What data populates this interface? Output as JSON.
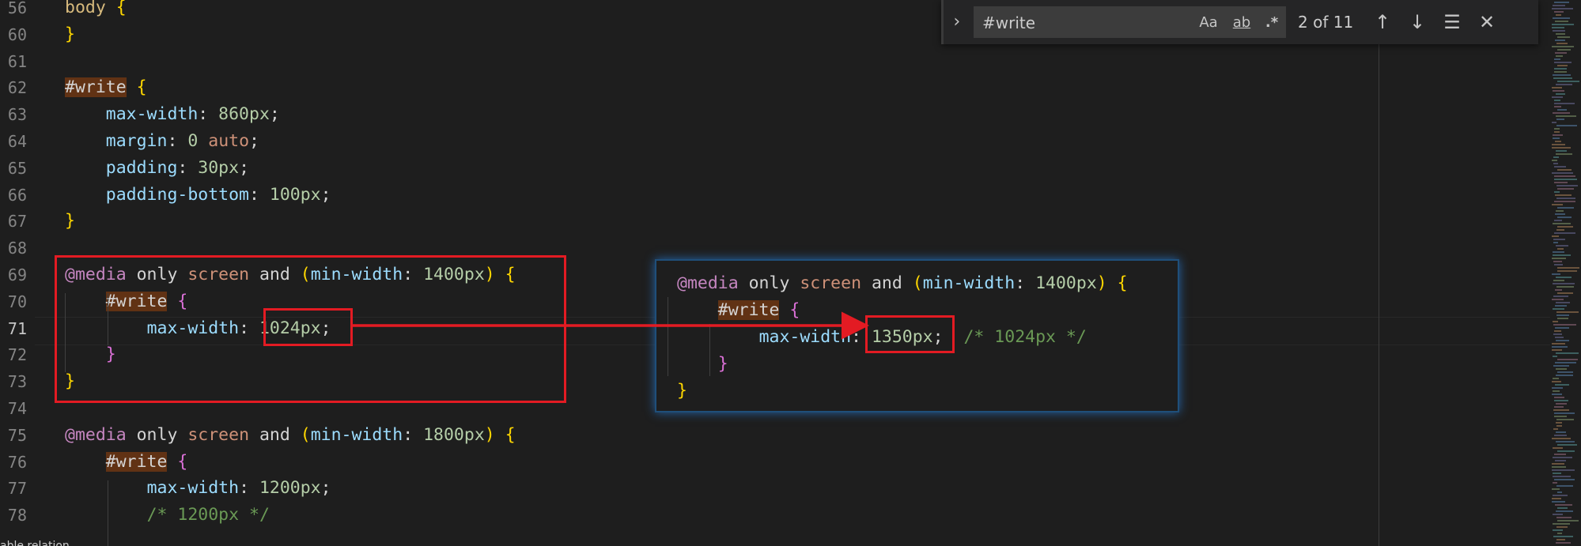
{
  "lines": [
    {
      "num": "56",
      "tokens": [
        [
          "id",
          "body "
        ],
        [
          "brace",
          "{"
        ]
      ]
    },
    {
      "num": "60",
      "tokens": [
        [
          "brace",
          "}"
        ]
      ]
    },
    {
      "num": "61",
      "tokens": []
    },
    {
      "num": "62",
      "tokens": [
        [
          "hl",
          "#write"
        ],
        [
          "plain",
          " "
        ],
        [
          "brace",
          "{"
        ]
      ]
    },
    {
      "num": "63",
      "tokens": [
        [
          "plain",
          "    "
        ],
        [
          "prop",
          "max-width"
        ],
        [
          "plain",
          ": "
        ],
        [
          "num",
          "860px"
        ],
        [
          "plain",
          ";"
        ]
      ]
    },
    {
      "num": "64",
      "tokens": [
        [
          "plain",
          "    "
        ],
        [
          "prop",
          "margin"
        ],
        [
          "plain",
          ": "
        ],
        [
          "num",
          "0"
        ],
        [
          "plain",
          " "
        ],
        [
          "kw",
          "auto"
        ],
        [
          "plain",
          ";"
        ]
      ]
    },
    {
      "num": "65",
      "tokens": [
        [
          "plain",
          "    "
        ],
        [
          "prop",
          "padding"
        ],
        [
          "plain",
          ": "
        ],
        [
          "num",
          "30px"
        ],
        [
          "plain",
          ";"
        ]
      ]
    },
    {
      "num": "66",
      "tokens": [
        [
          "plain",
          "    "
        ],
        [
          "prop",
          "padding-bottom"
        ],
        [
          "plain",
          ": "
        ],
        [
          "num",
          "100px"
        ],
        [
          "plain",
          ";"
        ]
      ]
    },
    {
      "num": "67",
      "tokens": [
        [
          "brace",
          "}"
        ]
      ]
    },
    {
      "num": "68",
      "tokens": []
    },
    {
      "num": "69",
      "tokens": [
        [
          "at",
          "@media"
        ],
        [
          "plain",
          " only "
        ],
        [
          "kw",
          "screen"
        ],
        [
          "plain",
          " and "
        ],
        [
          "paren",
          "("
        ],
        [
          "prop",
          "min-width"
        ],
        [
          "plain",
          ": "
        ],
        [
          "num",
          "1400px"
        ],
        [
          "paren",
          ")"
        ],
        [
          "plain",
          " "
        ],
        [
          "brace",
          "{"
        ]
      ]
    },
    {
      "num": "70",
      "tokens": [
        [
          "plain",
          "    "
        ],
        [
          "hl",
          "#write"
        ],
        [
          "plain",
          " "
        ],
        [
          "brace2",
          "{"
        ]
      ]
    },
    {
      "num": "71",
      "tokens": [
        [
          "plain",
          "        "
        ],
        [
          "prop",
          "max-width"
        ],
        [
          "plain",
          ": "
        ],
        [
          "num",
          "1024px"
        ],
        [
          "plain",
          ";"
        ]
      ]
    },
    {
      "num": "72",
      "tokens": [
        [
          "plain",
          "    "
        ],
        [
          "brace2",
          "}"
        ]
      ]
    },
    {
      "num": "73",
      "tokens": [
        [
          "brace",
          "}"
        ]
      ]
    },
    {
      "num": "74",
      "tokens": []
    },
    {
      "num": "75",
      "tokens": [
        [
          "at",
          "@media"
        ],
        [
          "plain",
          " only "
        ],
        [
          "kw",
          "screen"
        ],
        [
          "plain",
          " and "
        ],
        [
          "paren",
          "("
        ],
        [
          "prop",
          "min-width"
        ],
        [
          "plain",
          ": "
        ],
        [
          "num",
          "1800px"
        ],
        [
          "paren",
          ")"
        ],
        [
          "plain",
          " "
        ],
        [
          "brace",
          "{"
        ]
      ]
    },
    {
      "num": "76",
      "tokens": [
        [
          "plain",
          "    "
        ],
        [
          "hl",
          "#write"
        ],
        [
          "plain",
          " "
        ],
        [
          "brace2",
          "{"
        ]
      ]
    },
    {
      "num": "77",
      "tokens": [
        [
          "plain",
          "        "
        ],
        [
          "prop",
          "max-width"
        ],
        [
          "plain",
          ": "
        ],
        [
          "num",
          "1200px"
        ],
        [
          "plain",
          ";"
        ]
      ]
    },
    {
      "num": "78",
      "tokens": [
        [
          "plain",
          "        "
        ],
        [
          "cmt",
          "/* 1200px */"
        ]
      ]
    }
  ],
  "active_line": "71",
  "find": {
    "query": "#write",
    "match_case_label": "Aa",
    "whole_word_label": "ab",
    "regex_label": ".*",
    "count": "2 of 11"
  },
  "preview_lines": [
    {
      "tokens": [
        [
          "at",
          "@media"
        ],
        [
          "plain",
          " only "
        ],
        [
          "kw",
          "screen"
        ],
        [
          "plain",
          " and "
        ],
        [
          "paren",
          "("
        ],
        [
          "prop",
          "min-width"
        ],
        [
          "plain",
          ": "
        ],
        [
          "num",
          "1400px"
        ],
        [
          "paren",
          ")"
        ],
        [
          "plain",
          " "
        ],
        [
          "brace",
          "{"
        ]
      ]
    },
    {
      "tokens": [
        [
          "plain",
          "    "
        ],
        [
          "hl",
          "#write"
        ],
        [
          "plain",
          " "
        ],
        [
          "brace2",
          "{"
        ]
      ]
    },
    {
      "tokens": [
        [
          "plain",
          "        "
        ],
        [
          "prop",
          "max-width"
        ],
        [
          "plain",
          ": "
        ],
        [
          "num",
          "1350px"
        ],
        [
          "plain",
          ";  "
        ],
        [
          "cmt",
          "/* 1024px */"
        ]
      ]
    },
    {
      "tokens": [
        [
          "plain",
          "    "
        ],
        [
          "brace2",
          "}"
        ]
      ]
    },
    {
      "tokens": [
        [
          "brace",
          "}"
        ]
      ]
    }
  ],
  "colors": {
    "callout": "#e31b23",
    "preview_glow": "#2563a6",
    "background": "#1e1e1e"
  },
  "status_fragment": "able relation"
}
